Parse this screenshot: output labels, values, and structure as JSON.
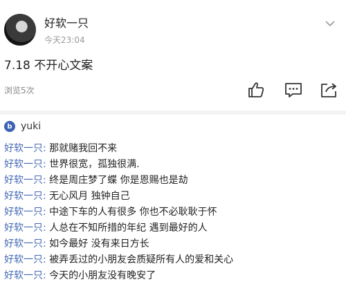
{
  "post": {
    "author": "好软一只",
    "time": "今天23:04",
    "title": "7.18 不开心文案",
    "views": "浏览5次"
  },
  "commenter": {
    "icon_letter": "b",
    "name": "yuki"
  },
  "colors": {
    "speaker": "#4469b4",
    "icon_bg": "#3b62b6"
  },
  "icons": [
    "chevron-down-icon",
    "thumbs-up-icon",
    "comment-icon",
    "share-icon"
  ],
  "lines": [
    {
      "speaker": "好软一只",
      "separator": ":",
      "text": "那就赌我回不来"
    },
    {
      "speaker": "好软一只",
      "separator": ":",
      "text": "世界很宽，孤独很满."
    },
    {
      "speaker": "好软一只",
      "separator": ":",
      "text": "终是周庄梦了蝶 你是恩赐也是劫"
    },
    {
      "speaker": "好软一只",
      "separator": ":",
      "text": "无心风月 独钟自己"
    },
    {
      "speaker": "好软一只",
      "separator": ":",
      "text": "中途下车的人有很多 你也不必耿耿于怀"
    },
    {
      "speaker": "好软一只",
      "separator": ":",
      "text": "人总在不知所措的年纪 遇到最好的人"
    },
    {
      "speaker": "好软一只",
      "separator": ":",
      "text": "如今最好 没有来日方长"
    },
    {
      "speaker": "好软一只",
      "separator": ":",
      "text": "被弄丢过的小朋友会质疑所有人的爱和关心"
    },
    {
      "speaker": "好软一只",
      "separator": ":",
      "text": "今天的小朋友没有晚安了"
    }
  ]
}
